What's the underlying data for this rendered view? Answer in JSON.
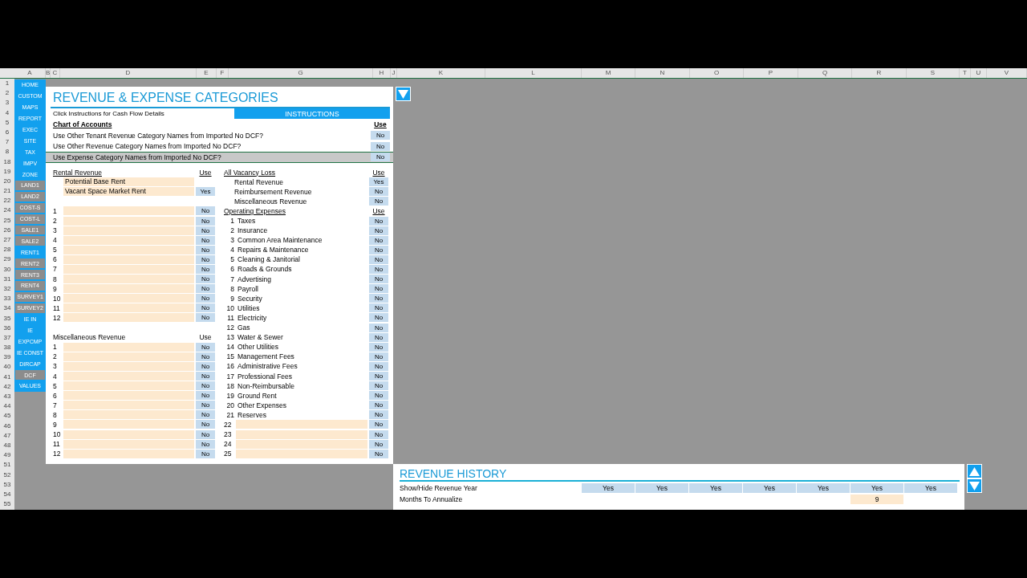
{
  "column_headers": [
    "A",
    "B",
    "C",
    "D",
    "E",
    "F",
    "G",
    "H",
    "J",
    "K",
    "L",
    "M",
    "N",
    "O",
    "P",
    "Q",
    "R",
    "S",
    "T",
    "U",
    "V"
  ],
  "row_numbers": [
    "1",
    "2",
    "3",
    "4",
    "5",
    "6",
    "7",
    "8",
    "18",
    "19",
    "20",
    "21",
    "22",
    "24",
    "25",
    "26",
    "27",
    "28",
    "29",
    "30",
    "31",
    "32",
    "33",
    "34",
    "35",
    "36",
    "37",
    "38",
    "39",
    "40",
    "41",
    "42",
    "43",
    "44",
    "45",
    "46",
    "47",
    "48",
    "49",
    "51",
    "52",
    "53",
    "54",
    "55"
  ],
  "sheet_tabs": [
    {
      "label": "HOME",
      "enabled": true
    },
    {
      "label": "CUSTOM",
      "enabled": true
    },
    {
      "label": "MAPS",
      "enabled": true
    },
    {
      "label": "REPORT",
      "enabled": true
    },
    {
      "label": "EXEC",
      "enabled": true
    },
    {
      "label": "SITE",
      "enabled": true
    },
    {
      "label": "TAX",
      "enabled": true
    },
    {
      "label": "IMPV",
      "enabled": true
    },
    {
      "label": "ZONE",
      "enabled": true
    },
    {
      "label": "LAND1",
      "enabled": false
    },
    {
      "label": "LAND2",
      "enabled": false
    },
    {
      "label": "COST-S",
      "enabled": false
    },
    {
      "label": "COST-L",
      "enabled": false
    },
    {
      "label": "SALE1",
      "enabled": false
    },
    {
      "label": "SALE2",
      "enabled": false
    },
    {
      "label": "RENT1",
      "enabled": true
    },
    {
      "label": "RENT2",
      "enabled": false
    },
    {
      "label": "RENT3",
      "enabled": false
    },
    {
      "label": "RENT4",
      "enabled": false
    },
    {
      "label": "SURVEY1",
      "enabled": false
    },
    {
      "label": "SURVEY2",
      "enabled": false
    },
    {
      "label": "IE IN",
      "enabled": true
    },
    {
      "label": "IE",
      "enabled": true
    },
    {
      "label": "EXPCMP",
      "enabled": true
    },
    {
      "label": "IE CONST",
      "enabled": true
    },
    {
      "label": "DIRCAP",
      "enabled": true
    },
    {
      "label": "DCF",
      "enabled": false
    },
    {
      "label": "VALUES",
      "enabled": true
    }
  ],
  "categories": {
    "title": "REVENUE & EXPENSE CATEGORIES",
    "hint": "Click Instructions for Cash Flow Details",
    "instructions_button": "INSTRUCTIONS",
    "chart_heading": "Chart of Accounts",
    "use_heading": "Use",
    "questions": [
      {
        "label": "Use Other Tenant Revenue Category Names from Imported No DCF?",
        "use": "No",
        "selected": false
      },
      {
        "label": "Use Other Revenue Category Names from Imported No DCF?",
        "use": "No",
        "selected": false
      },
      {
        "label": "Use Expense Category Names from Imported No DCF?",
        "use": "No",
        "selected": true
      }
    ],
    "left_column": [
      {
        "kind": "header",
        "label": "Rental Revenue",
        "use": "Use",
        "underline": true
      },
      {
        "kind": "input",
        "label": "Potential Base Rent"
      },
      {
        "kind": "input",
        "label": "Vacant Space  Market Rent",
        "use": "Yes"
      },
      {
        "kind": "blank"
      },
      {
        "kind": "input",
        "number": "1",
        "use": "No"
      },
      {
        "kind": "input",
        "number": "2",
        "use": "No"
      },
      {
        "kind": "input",
        "number": "3",
        "use": "No"
      },
      {
        "kind": "input",
        "number": "4",
        "use": "No"
      },
      {
        "kind": "input",
        "number": "5",
        "use": "No"
      },
      {
        "kind": "input",
        "number": "6",
        "use": "No"
      },
      {
        "kind": "input",
        "number": "7",
        "use": "No"
      },
      {
        "kind": "input",
        "number": "8",
        "use": "No"
      },
      {
        "kind": "input",
        "number": "9",
        "use": "No"
      },
      {
        "kind": "input",
        "number": "10",
        "use": "No"
      },
      {
        "kind": "input",
        "number": "11",
        "use": "No"
      },
      {
        "kind": "input",
        "number": "12",
        "use": "No"
      },
      {
        "kind": "blank"
      },
      {
        "kind": "header",
        "label": "Miscellaneous Revenue",
        "use": "Use",
        "underline": false
      },
      {
        "kind": "input",
        "number": "1",
        "use": "No"
      },
      {
        "kind": "input",
        "number": "2",
        "use": "No"
      },
      {
        "kind": "input",
        "number": "3",
        "use": "No"
      },
      {
        "kind": "input",
        "number": "4",
        "use": "No"
      },
      {
        "kind": "input",
        "number": "5",
        "use": "No"
      },
      {
        "kind": "input",
        "number": "6",
        "use": "No"
      },
      {
        "kind": "input",
        "number": "7",
        "use": "No"
      },
      {
        "kind": "input",
        "number": "8",
        "use": "No"
      },
      {
        "kind": "input",
        "number": "9",
        "use": "No"
      },
      {
        "kind": "input",
        "number": "10",
        "use": "No"
      },
      {
        "kind": "input",
        "number": "11",
        "use": "No"
      },
      {
        "kind": "input",
        "number": "12",
        "use": "No"
      }
    ],
    "right_column": [
      {
        "kind": "header",
        "label": "All Vacancy Loss",
        "use": "Use",
        "underline": true
      },
      {
        "kind": "sub",
        "label": "Rental Revenue",
        "use": "Yes"
      },
      {
        "kind": "sub",
        "label": "Reimbursement Revenue",
        "use": "No"
      },
      {
        "kind": "sub",
        "label": "Miscellaneous Revenue",
        "use": "No"
      },
      {
        "kind": "header",
        "label": "Operating Expenses",
        "use": "Use",
        "underline": true
      },
      {
        "kind": "text",
        "number": "1",
        "label": "Taxes",
        "use": "No"
      },
      {
        "kind": "text",
        "number": "2",
        "label": "Insurance",
        "use": "No"
      },
      {
        "kind": "text",
        "number": "3",
        "label": "Common Area Maintenance",
        "use": "No"
      },
      {
        "kind": "text",
        "number": "4",
        "label": "Repairs & Maintenance",
        "use": "No"
      },
      {
        "kind": "text",
        "number": "5",
        "label": "Cleaning & Janitorial",
        "use": "No"
      },
      {
        "kind": "text",
        "number": "6",
        "label": "Roads & Grounds",
        "use": "No"
      },
      {
        "kind": "text",
        "number": "7",
        "label": "Advertising",
        "use": "No"
      },
      {
        "kind": "text",
        "number": "8",
        "label": "Payroll",
        "use": "No"
      },
      {
        "kind": "text",
        "number": "9",
        "label": "Security",
        "use": "No"
      },
      {
        "kind": "text",
        "number": "10",
        "label": "Utilities",
        "use": "No"
      },
      {
        "kind": "text",
        "number": "11",
        "label": "Electricity",
        "use": "No"
      },
      {
        "kind": "text",
        "number": "12",
        "label": "Gas",
        "use": "No"
      },
      {
        "kind": "text",
        "number": "13",
        "label": "Water & Sewer",
        "use": "No"
      },
      {
        "kind": "text",
        "number": "14",
        "label": "Other Utilities",
        "use": "No"
      },
      {
        "kind": "text",
        "number": "15",
        "label": "Management Fees",
        "use": "No"
      },
      {
        "kind": "text",
        "number": "16",
        "label": "Administrative Fees",
        "use": "No"
      },
      {
        "kind": "text",
        "number": "17",
        "label": "Professional Fees",
        "use": "No"
      },
      {
        "kind": "text",
        "number": "18",
        "label": "Non-Reimbursable",
        "use": "No"
      },
      {
        "kind": "text",
        "number": "19",
        "label": "Ground Rent",
        "use": "No"
      },
      {
        "kind": "text",
        "number": "20",
        "label": "Other Expenses",
        "use": "No"
      },
      {
        "kind": "text",
        "number": "21",
        "label": "Reserves",
        "use": "No"
      },
      {
        "kind": "input",
        "number": "22",
        "use": "No"
      },
      {
        "kind": "input",
        "number": "23",
        "use": "No"
      },
      {
        "kind": "input",
        "number": "24",
        "use": "No"
      },
      {
        "kind": "input",
        "number": "25",
        "use": "No"
      }
    ]
  },
  "revenue_history": {
    "title": "REVENUE HISTORY",
    "show_hide": {
      "label": "Show/Hide Revenue Year",
      "values": [
        "Yes",
        "Yes",
        "Yes",
        "Yes",
        "Yes",
        "Yes",
        "Yes"
      ]
    },
    "months": {
      "label": "Months To Annualize",
      "value": "9"
    }
  }
}
